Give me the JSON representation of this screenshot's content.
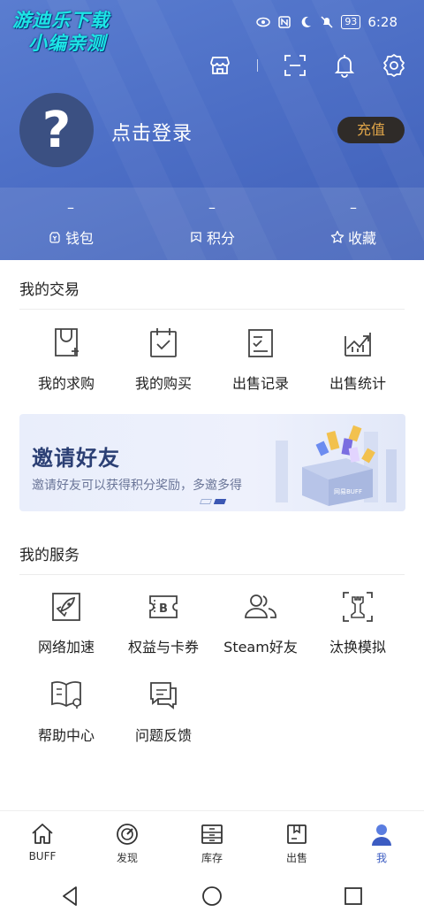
{
  "watermark": {
    "line1": "游迪乐下载",
    "line2": "小编亲测"
  },
  "statusbar": {
    "battery": "93",
    "time": "6:28",
    "icons": [
      "wifi-icon",
      "eye-icon",
      "nfc-icon",
      "moon-icon",
      "mute-icon"
    ]
  },
  "header": {
    "icons": [
      "store-icon",
      "scan-icon",
      "bell-icon",
      "settings-icon"
    ],
    "avatar_glyph": "?",
    "login_text": "点击登录",
    "recharge_label": "充值",
    "stats": [
      {
        "value": "–",
        "label": "钱包",
        "icon": "wallet-icon"
      },
      {
        "value": "–",
        "label": "积分",
        "icon": "points-icon"
      },
      {
        "value": "–",
        "label": "收藏",
        "icon": "star-icon"
      }
    ]
  },
  "trade": {
    "title": "我的交易",
    "items": [
      {
        "label": "我的求购",
        "icon": "bag-add-icon"
      },
      {
        "label": "我的购买",
        "icon": "calendar-check-icon"
      },
      {
        "label": "出售记录",
        "icon": "record-icon"
      },
      {
        "label": "出售统计",
        "icon": "chart-icon"
      }
    ]
  },
  "banner": {
    "title": "邀请好友",
    "subtitle": "邀请好友可以获得积分奖励，多邀多得",
    "box_text": "网易BUFF"
  },
  "services": {
    "title": "我的服务",
    "items": [
      {
        "label": "网络加速",
        "icon": "rocket-icon"
      },
      {
        "label": "权益与卡券",
        "icon": "coupon-icon"
      },
      {
        "label": "Steam好友",
        "icon": "friends-icon"
      },
      {
        "label": "汰换模拟",
        "icon": "tradeup-icon"
      },
      {
        "label": "帮助中心",
        "icon": "help-book-icon"
      },
      {
        "label": "问题反馈",
        "icon": "feedback-icon"
      }
    ]
  },
  "tabbar": [
    {
      "label": "BUFF",
      "icon": "home-icon",
      "active": false
    },
    {
      "label": "发现",
      "icon": "discover-icon",
      "active": false
    },
    {
      "label": "库存",
      "icon": "inventory-icon",
      "active": false
    },
    {
      "label": "出售",
      "icon": "sell-box-icon",
      "active": false
    },
    {
      "label": "我",
      "icon": "profile-icon",
      "active": true
    }
  ],
  "colors": {
    "header": "#4d6fc6",
    "accent": "#3c5cc2",
    "recharge_bg": "#2f2b28",
    "recharge_text": "#e2a74a"
  }
}
